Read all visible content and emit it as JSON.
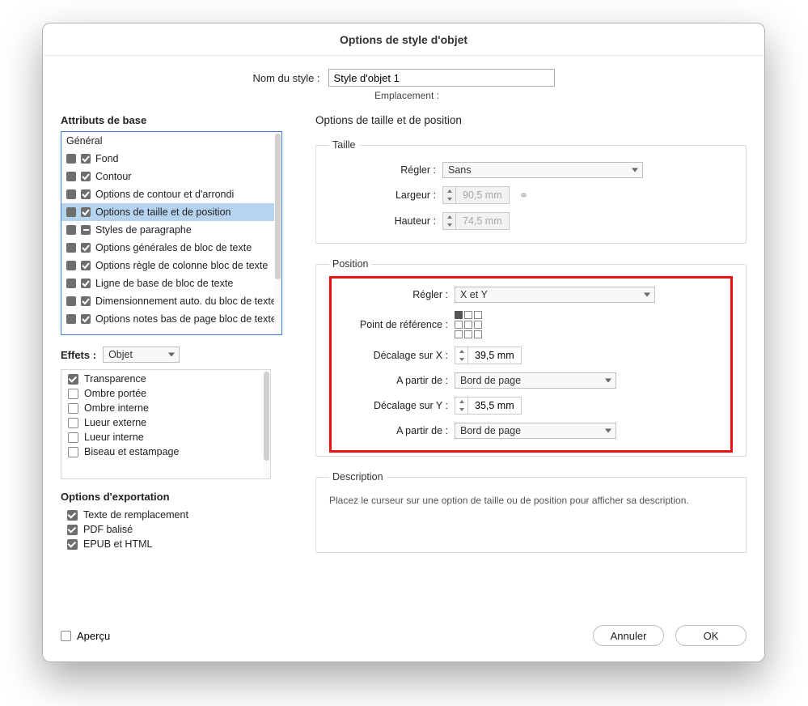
{
  "window": {
    "title": "Options de style d'objet"
  },
  "style_name": {
    "label": "Nom du style :",
    "value": "Style d'objet 1"
  },
  "location": {
    "label": "Emplacement :"
  },
  "left": {
    "attributes_title": "Attributs de base",
    "attributes": [
      {
        "label": "Général",
        "kind": "plain"
      },
      {
        "label": "Fond",
        "kind": "checked"
      },
      {
        "label": "Contour",
        "kind": "checked"
      },
      {
        "label": "Options de contour et d'arrondi",
        "kind": "checked"
      },
      {
        "label": "Options de taille et de position",
        "kind": "checked",
        "selected": true
      },
      {
        "label": "Styles de paragraphe",
        "kind": "dash"
      },
      {
        "label": "Options générales de bloc de texte",
        "kind": "checked"
      },
      {
        "label": "Options règle de colonne bloc de texte",
        "kind": "checked"
      },
      {
        "label": "Ligne de base de bloc de texte",
        "kind": "checked"
      },
      {
        "label": "Dimensionnement auto. du bloc de texte",
        "kind": "checked"
      },
      {
        "label": "Options notes bas de page bloc de texte",
        "kind": "checked"
      }
    ],
    "effects_label": "Effets :",
    "effects_select": "Objet",
    "effects": [
      {
        "label": "Transparence",
        "checked": true
      },
      {
        "label": "Ombre portée",
        "checked": false
      },
      {
        "label": "Ombre interne",
        "checked": false
      },
      {
        "label": "Lueur externe",
        "checked": false
      },
      {
        "label": "Lueur interne",
        "checked": false
      },
      {
        "label": "Biseau et estampage",
        "checked": false
      }
    ],
    "export_title": "Options d'exportation",
    "export": [
      {
        "label": "Texte de remplacement",
        "checked": true
      },
      {
        "label": "PDF balisé",
        "checked": true
      },
      {
        "label": "EPUB et HTML",
        "checked": true
      }
    ]
  },
  "right": {
    "panel_title": "Options de taille et de position",
    "size": {
      "legend": "Taille",
      "adjust_label": "Régler :",
      "adjust_value": "Sans",
      "width_label": "Largeur :",
      "width_value": "90,5 mm",
      "height_label": "Hauteur :",
      "height_value": "74,5 mm"
    },
    "position": {
      "legend": "Position",
      "adjust_label": "Régler :",
      "adjust_value": "X et Y",
      "refpoint_label": "Point de référence :",
      "offset_x_label": "Décalage sur X :",
      "offset_x_value": "39,5 mm",
      "from_x_label": "A partir de :",
      "from_x_value": "Bord de page",
      "offset_y_label": "Décalage sur Y :",
      "offset_y_value": "35,5 mm",
      "from_y_label": "A partir de :",
      "from_y_value": "Bord de page"
    },
    "description": {
      "legend": "Description",
      "text": "Placez le curseur sur une option de taille ou de position pour afficher sa description."
    }
  },
  "footer": {
    "preview": "Aperçu",
    "cancel": "Annuler",
    "ok": "OK"
  }
}
